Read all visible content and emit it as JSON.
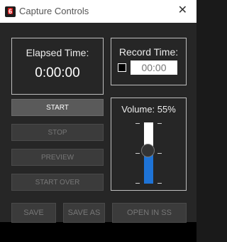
{
  "window": {
    "title": "Capture Controls",
    "icon_text": "6",
    "close_glyph": "✕"
  },
  "elapsed": {
    "label": "Elapsed Time:",
    "value": "0:00:00"
  },
  "record": {
    "label": "Record Time:",
    "placeholder": "00:00",
    "checked": false
  },
  "buttons": {
    "start": "START",
    "stop": "STOP",
    "preview": "PREVIEW",
    "start_over": "START OVER",
    "save": "SAVE",
    "save_as": "SAVE AS",
    "open_in_ss": "OPEN IN SS"
  },
  "volume": {
    "label": "Volume: 55%",
    "level": 0.55
  },
  "colors": {
    "accent": "#1e73d6",
    "brand": "#d11a1a"
  }
}
